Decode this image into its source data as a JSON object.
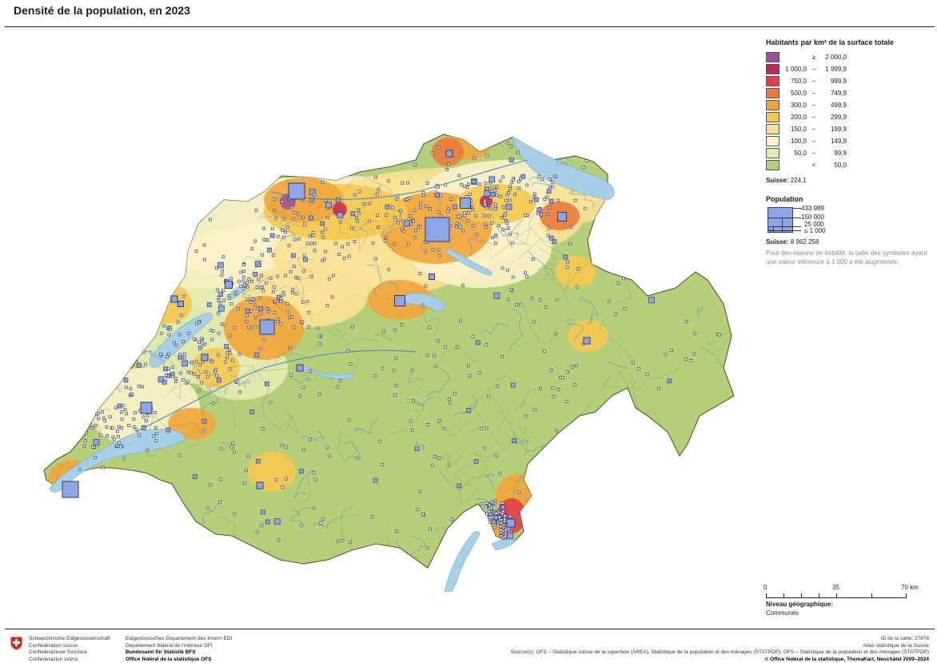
{
  "title": "Densité de la population, en 2023",
  "legend": {
    "title": "Habitants par km² de la surface totale",
    "classes": [
      {
        "from": "",
        "op": "≥",
        "to": "2 000,0",
        "color": "#9c4f9e"
      },
      {
        "from": "1 000,0",
        "op": "–",
        "to": "1 999,9",
        "color": "#c4265a"
      },
      {
        "from": "750,0",
        "op": "–",
        "to": "999,9",
        "color": "#e33e49"
      },
      {
        "from": "500,0",
        "op": "–",
        "to": "749,9",
        "color": "#eb7b3b"
      },
      {
        "from": "300,0",
        "op": "–",
        "to": "499,9",
        "color": "#f2a43a"
      },
      {
        "from": "200,0",
        "op": "–",
        "to": "299,9",
        "color": "#f6c850"
      },
      {
        "from": "150,0",
        "op": "–",
        "to": "199,9",
        "color": "#f8e192"
      },
      {
        "from": "100,0",
        "op": "–",
        "to": "149,9",
        "color": "#fbf1c8"
      },
      {
        "from": "50,0",
        "op": "–",
        "to": "99,9",
        "color": "#e4eab1"
      },
      {
        "from": "",
        "op": "<",
        "to": "50,0",
        "color": "#b6d07a"
      }
    ],
    "total_label": "Suisse:",
    "total_value": "224,1",
    "population_title": "Population",
    "population_values": [
      "433 989",
      "150 000",
      "25 000",
      "≤ 1 000"
    ],
    "population_total_label": "Suisse:",
    "population_total_value": "8 962 258",
    "note": "Pour des raisons de lisibilité, la taille des symboles ayant une valeur inférieure à 1 000 a été augmentée."
  },
  "scale": {
    "labels": [
      "0",
      "35",
      "70 km"
    ]
  },
  "geo_level": {
    "label": "Niveau géographique:",
    "value": "Communes"
  },
  "colors": {
    "base": "#b6d07a",
    "lake": "#a7cfe8",
    "river": "#3f8ec9",
    "symbol_fill": "#8ea5e6",
    "symbol_stroke": "#2f3a70",
    "outside": "#ffffff"
  },
  "footer": {
    "federal": [
      "Schweizerische Eidgenossenschaft",
      "Confédération suisse",
      "Confederazione Svizzera",
      "Confederaziun svizra"
    ],
    "department": [
      "Eidgenössisches Departement des Innern EDI",
      "Département fédéral de l'intérieur DFI"
    ],
    "office": [
      "Bundesamt für Statistik BFS",
      "Office fédéral de la statistique OFS"
    ],
    "card_id": "ID de la carte: 27876",
    "atlas": "Atlas statistique de la Suisse",
    "source": "Source(s): OFS – Statistique suisse de la superficie (AREA), Statistique de la population et des ménages (STATPOP); OFS – Statistique de la population et des ménages (STATPOP)",
    "copyright": "© Office fédéral de la statistique, ThemaKart, Neuchâtel 2009–2024"
  }
}
